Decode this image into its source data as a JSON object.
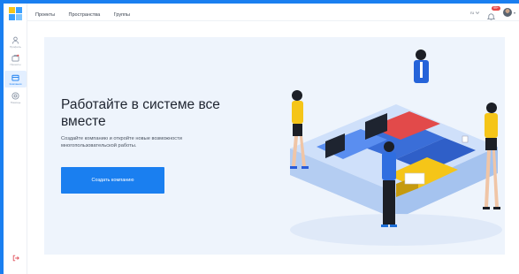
{
  "topbar": {
    "nav": [
      "Проекты",
      "Пространства",
      "Группы"
    ],
    "lang": "ru",
    "notifications_badge": "99+"
  },
  "sidebar": {
    "items": [
      {
        "label": "Профиль",
        "icon": "user-icon"
      },
      {
        "label": "Проекты",
        "icon": "projects-icon"
      },
      {
        "label": "Компании",
        "icon": "company-icon",
        "active": true
      },
      {
        "label": "Помощь",
        "icon": "help-icon"
      }
    ]
  },
  "hero": {
    "title": "Работайте в системе все вместе",
    "subtitle": "Создайте компанию и откройте новые возможности многопользовательской работы.",
    "button_label": "Создать компанию"
  },
  "colors": {
    "accent": "#1a7ff0",
    "hero_bg": "#eef4fc",
    "badge": "#e84545"
  }
}
